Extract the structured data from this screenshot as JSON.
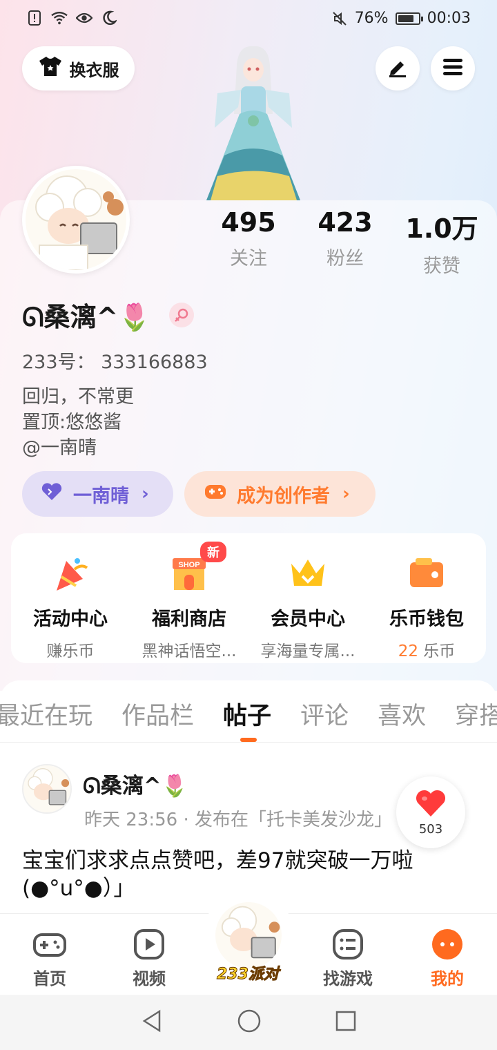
{
  "status_bar": {
    "battery": "76%",
    "time": "00:03"
  },
  "header": {
    "dress_button_label": "换衣服"
  },
  "profile": {
    "username": "ᘏ桑漓^🌷",
    "stats": [
      {
        "value": "495",
        "label": "关注"
      },
      {
        "value": "423",
        "label": "粉丝"
      },
      {
        "value": "1.0万",
        "label": "获赞"
      }
    ],
    "uid_line": "233号： 333166883",
    "bio_lines": [
      "回归，不常更",
      "置顶:悠悠酱",
      "@一南晴"
    ],
    "pill_friend": "一南晴",
    "pill_creator": "成为创作者"
  },
  "quick_links": [
    {
      "title": "活动中心",
      "sub": "赚乐币"
    },
    {
      "title": "福利商店",
      "sub": "黑神话悟空...",
      "badge": "新"
    },
    {
      "title": "会员中心",
      "sub": "享海量专属..."
    },
    {
      "title": "乐币钱包",
      "sub_num": "22",
      "sub_unit": " 乐币"
    }
  ],
  "tabs": [
    "最近在玩",
    "作品栏",
    "帖子",
    "评论",
    "喜欢",
    "穿搭"
  ],
  "active_tab": "帖子",
  "post": {
    "author": "ᘏ桑漓^🌷",
    "meta": "昨天 23:56 · 发布在「托卡美发沙龙」",
    "likes": "503",
    "text": "宝宝们求求点点赞吧，差97就突破一万啦(●°u°●）」"
  },
  "bottom_nav": [
    {
      "label": "首页",
      "icon": "gamepad-icon"
    },
    {
      "label": "视频",
      "icon": "play-icon"
    },
    {
      "label": "233派对",
      "icon": "party-avatar"
    },
    {
      "label": "找游戏",
      "icon": "list-icon"
    },
    {
      "label": "我的",
      "icon": "me-icon"
    }
  ],
  "colors": {
    "accent": "#ff6a1f",
    "purple": "#6f5fd6",
    "coin": "#ff7a2e"
  }
}
